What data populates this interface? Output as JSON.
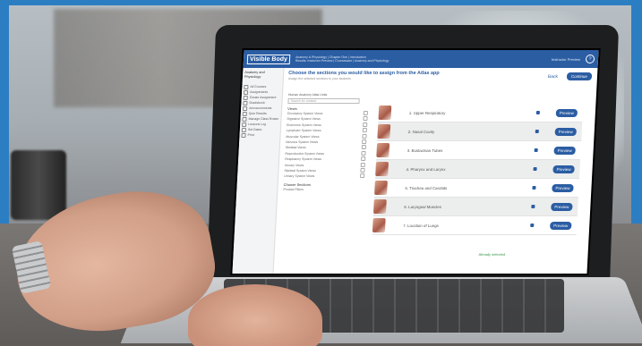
{
  "app": {
    "logo": "Visible Body",
    "meta_lines": [
      "Anatomy & Physiology | Chapter One | Introduction",
      "Results: Instructor Preview | Courseware | Anatomy and Physiology"
    ],
    "user": "Instructor Preview"
  },
  "sidebar": {
    "course_title": "Anatomy and Physiology",
    "items": [
      "All Courses",
      "Assignments",
      "Create Assignment",
      "Gradebook",
      "Announcements",
      "Quiz Results",
      "Manage Class Roster",
      "Lessons Log",
      "Set Dates",
      "Print"
    ]
  },
  "main": {
    "title": "Choose the sections you would like to assign from the Atlas app",
    "subtitle": "Assign the selected sections to your students",
    "back_label": "Back",
    "continue_label": "Continue"
  },
  "picker": {
    "heading": "Human Anatomy Atlas Units",
    "search_placeholder": "Search for content",
    "view_label": "Views",
    "items": [
      "Circulatory System Views",
      "Digestive System Views",
      "Endocrine System Views",
      "Lymphatic System Views",
      "Muscular System Views",
      "Nervous System Views",
      "Skeletal Views",
      "Reproductive System Views",
      "Respiratory System Views",
      "Urinary Views",
      "Skeletal System Views",
      "Urinary System Views"
    ],
    "more_label": "Choose Sections",
    "filter_label": "Product Filters"
  },
  "rows": [
    {
      "label": "1. Upper Respiratory",
      "preview": "Preview"
    },
    {
      "label": "2. Nasal Cavity",
      "preview": "Preview"
    },
    {
      "label": "3. Eustachian Tubes",
      "preview": "Preview"
    },
    {
      "label": "4. Pharynx and Larynx",
      "preview": "Preview"
    },
    {
      "label": "5. Trachea and Carotids",
      "preview": "Preview"
    },
    {
      "label": "6. Laryngeal Muscles",
      "preview": "Preview"
    },
    {
      "label": "7. Location of Lungs",
      "preview": "Preview"
    }
  ],
  "status": "Already selected",
  "colors": {
    "brand": "#2b5da3",
    "frame": "#2c7ec3",
    "success": "#3a9a4a"
  }
}
